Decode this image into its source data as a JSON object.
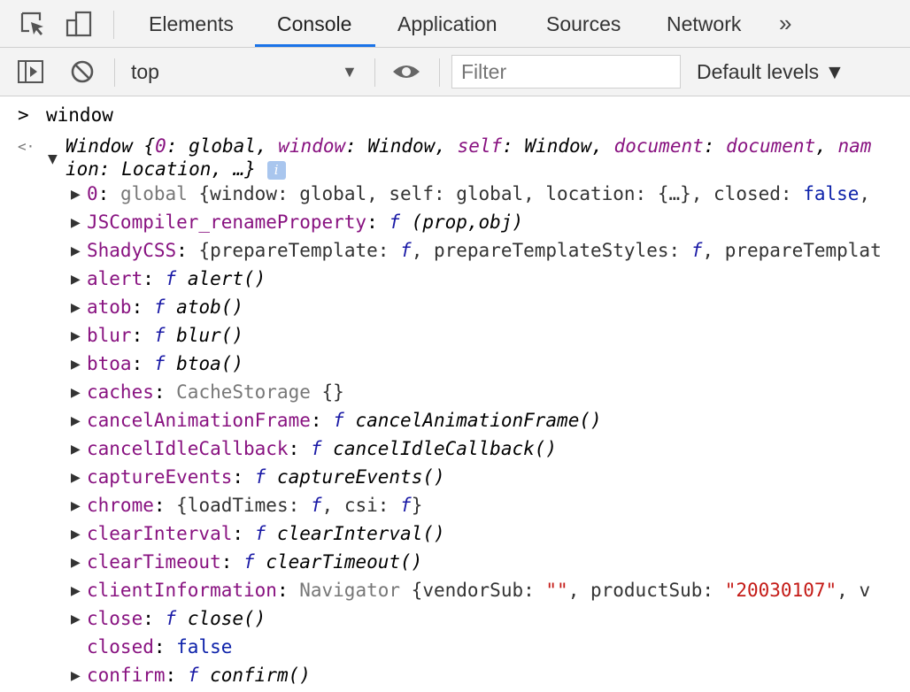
{
  "tabs": [
    "Elements",
    "Console",
    "Application",
    "Sources",
    "Network"
  ],
  "more_tabs": "»",
  "toolbar": {
    "context": "top",
    "context_arrow": "▼",
    "filter_placeholder": "Filter",
    "levels": "Default levels ▼"
  },
  "console": {
    "input_prompt": ">",
    "input": "window",
    "result_marker": "<·",
    "summary": {
      "head": "Window {",
      "p0k": "0",
      "p0v": "global",
      "p1k": "window",
      "p1v": "Window",
      "p2k": "self",
      "p2v": "Window",
      "p3k": "document",
      "p3v": "document",
      "p4k": "nam",
      "line2": "ion: Location, …}",
      "info": "i"
    },
    "props": [
      {
        "key": "0",
        "parts": [
          [
            "g",
            "global"
          ],
          [
            "ks",
            " {window: global, self: global, location: {…}, closed: "
          ],
          [
            "bool",
            "false"
          ],
          [
            "ks",
            ","
          ]
        ]
      },
      {
        "key": "JSCompiler_renameProperty",
        "parts": [
          [
            "f",
            "f"
          ],
          [
            "it",
            " (prop,obj)"
          ]
        ]
      },
      {
        "key": "ShadyCSS",
        "parts": [
          [
            "ks",
            "{prepareTemplate: "
          ],
          [
            "f",
            "f"
          ],
          [
            "ks",
            ", prepareTemplateStyles: "
          ],
          [
            "f",
            "f"
          ],
          [
            "ks",
            ", prepareTemplat"
          ]
        ]
      },
      {
        "key": "alert",
        "parts": [
          [
            "f",
            "f"
          ],
          [
            "it",
            " alert()"
          ]
        ]
      },
      {
        "key": "atob",
        "parts": [
          [
            "f",
            "f"
          ],
          [
            "it",
            " atob()"
          ]
        ]
      },
      {
        "key": "blur",
        "parts": [
          [
            "f",
            "f"
          ],
          [
            "it",
            " blur()"
          ]
        ]
      },
      {
        "key": "btoa",
        "parts": [
          [
            "f",
            "f"
          ],
          [
            "it",
            " btoa()"
          ]
        ]
      },
      {
        "key": "caches",
        "parts": [
          [
            "g",
            "CacheStorage"
          ],
          [
            "ks",
            " {}"
          ]
        ]
      },
      {
        "key": "cancelAnimationFrame",
        "parts": [
          [
            "f",
            "f"
          ],
          [
            "it",
            " cancelAnimationFrame()"
          ]
        ]
      },
      {
        "key": "cancelIdleCallback",
        "parts": [
          [
            "f",
            "f"
          ],
          [
            "it",
            " cancelIdleCallback()"
          ]
        ]
      },
      {
        "key": "captureEvents",
        "parts": [
          [
            "f",
            "f"
          ],
          [
            "it",
            " captureEvents()"
          ]
        ]
      },
      {
        "key": "chrome",
        "parts": [
          [
            "ks",
            "{loadTimes: "
          ],
          [
            "f",
            "f"
          ],
          [
            "ks",
            ", csi: "
          ],
          [
            "f",
            "f"
          ],
          [
            "ks",
            "}"
          ]
        ]
      },
      {
        "key": "clearInterval",
        "parts": [
          [
            "f",
            "f"
          ],
          [
            "it",
            " clearInterval()"
          ]
        ]
      },
      {
        "key": "clearTimeout",
        "parts": [
          [
            "f",
            "f"
          ],
          [
            "it",
            " clearTimeout()"
          ]
        ]
      },
      {
        "key": "clientInformation",
        "parts": [
          [
            "g",
            "Navigator"
          ],
          [
            "ks",
            " {vendorSub: "
          ],
          [
            "str",
            "\"\""
          ],
          [
            "ks",
            ", productSub: "
          ],
          [
            "str",
            "\"20030107\""
          ],
          [
            "ks",
            ", v"
          ]
        ]
      },
      {
        "key": "close",
        "parts": [
          [
            "f",
            "f"
          ],
          [
            "it",
            " close()"
          ]
        ]
      },
      {
        "key": "closed",
        "noarrow": true,
        "parts": [
          [
            "bool",
            "false"
          ]
        ]
      },
      {
        "key": "confirm",
        "parts": [
          [
            "f",
            "f"
          ],
          [
            "it",
            " confirm()"
          ]
        ]
      }
    ]
  },
  "colors": {
    "accent": "#1a73e8",
    "key": "#881280",
    "function": "#1a1aa6",
    "string": "#c41a16",
    "boolean": "#0d22aa"
  }
}
